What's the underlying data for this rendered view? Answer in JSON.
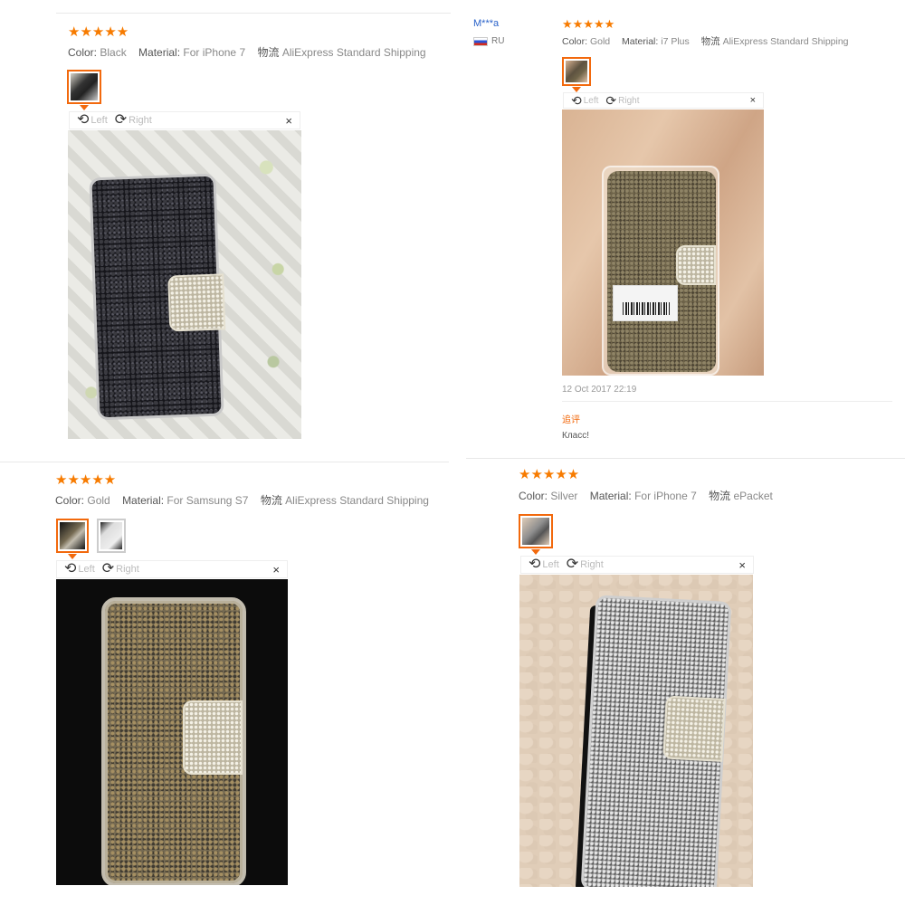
{
  "reviews": [
    {
      "stars": "★★★★★",
      "color_key": "Color:",
      "color_val": "Black",
      "material_key": "Material:",
      "material_val": "For iPhone 7",
      "ship_key": "物流",
      "ship_val": "AliExpress Standard Shipping"
    },
    {
      "user": "M***a",
      "country": "RU",
      "stars": "★★★★★",
      "color_key": "Color:",
      "color_val": "Gold",
      "material_key": "Material:",
      "material_val": "i7 Plus",
      "ship_key": "物流",
      "ship_val": "AliExpress Standard Shipping",
      "date": "12 Oct 2017 22:19",
      "reply_key": "追评",
      "reply_text": "Класс!"
    },
    {
      "stars": "★★★★★",
      "color_key": "Color:",
      "color_val": "Gold",
      "material_key": "Material:",
      "material_val": "For Samsung S7",
      "ship_key": "物流",
      "ship_val": "AliExpress Standard Shipping"
    },
    {
      "stars": "★★★★★",
      "color_key": "Color:",
      "color_val": "Silver",
      "material_key": "Material:",
      "material_val": "For iPhone 7",
      "ship_key": "物流",
      "ship_val": "ePacket"
    }
  ],
  "viewer": {
    "rotate_left": "Left",
    "rotate_right": "Right",
    "close": "×"
  },
  "icons": {
    "rotate_left": "rotate-left-icon",
    "rotate_right": "rotate-right-icon",
    "close": "close-icon",
    "star": "star-icon",
    "flag": "russia-flag-icon"
  },
  "colors": {
    "accent": "#f2690d",
    "star": "#f77b00",
    "user_link": "#2a62c9"
  }
}
